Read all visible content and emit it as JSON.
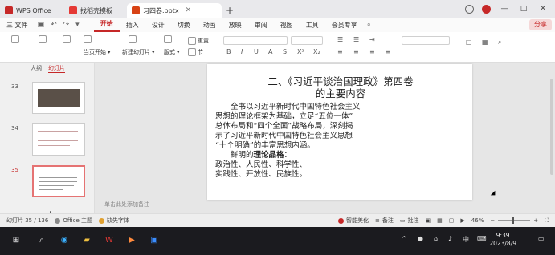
{
  "titlebar": {
    "tabs": [
      {
        "label": "WPS Office",
        "icon": "wps-logo-icon"
      },
      {
        "label": "找稻壳模板",
        "icon": "docer-icon"
      },
      {
        "label": "习四卷.pptx",
        "icon": "ppt-file-icon"
      }
    ],
    "new_tab": "+",
    "window_controls": [
      "—",
      "□",
      "✕"
    ]
  },
  "menu": {
    "file_label": "三 文件",
    "items": [
      "开始",
      "插入",
      "设计",
      "切换",
      "动画",
      "放映",
      "审阅",
      "视图",
      "工具",
      "会员专享"
    ],
    "active": "开始",
    "share_label": "分享"
  },
  "ribbon": {
    "current_page_start": "当页开始",
    "new_slide": "新建幻灯片",
    "layout": "版式",
    "reset": "重置",
    "section": "节"
  },
  "leftpanel": {
    "tabs": [
      "大纲",
      "幻灯片"
    ],
    "active_tab": "幻灯片",
    "slide_numbers": [
      "33",
      "34",
      "35"
    ],
    "add": "+"
  },
  "slide": {
    "title_line1": "二、《习近平谈治国理政》第四卷",
    "title_line2": "的主要内容",
    "para1": [
      "　　全书以习近平新时代中国特色社会主义",
      "思想的理论框架为基础，立足“五位一体”",
      "总体布局和“四个全面”战略布局，深刻揭",
      "示了习近平新时代中国特色社会主义思想",
      "“十个明确”的丰富思想内涵。"
    ],
    "para2_prefix": "　　鲜明的",
    "para2_bold": "理论品格",
    "para2_suffix": "：",
    "line3": "政治性、人民性、科学性、",
    "line4": "实践性、开放性、民族性。"
  },
  "notes_hint": "单击此处添加备注",
  "status": {
    "slide_counter": "幻灯片 35 / 136",
    "theme": "Office 主题",
    "missing_font": "缺失字体",
    "smart_beautify": "智能美化",
    "notes": "备注",
    "comments": "批注",
    "zoom": "46%"
  },
  "taskbar": {
    "time": "9:39",
    "date": "2023/8/9",
    "tray_lang": "中"
  },
  "colors": {
    "accent": "#c62828",
    "taskbar": "#1b1b1f"
  }
}
